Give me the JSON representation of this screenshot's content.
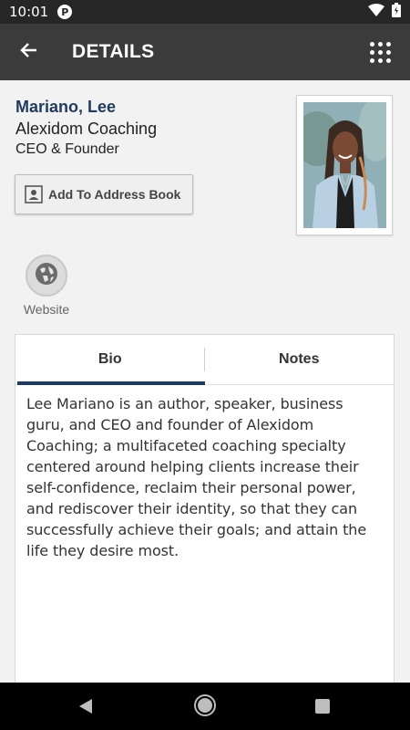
{
  "status_bar": {
    "time": "10:01",
    "app_badge": "P",
    "icons": [
      "wifi-icon",
      "battery-icon"
    ]
  },
  "app_bar": {
    "title": "DETAILS",
    "back_icon": "arrow-left-icon",
    "menu_icon": "grid-menu-icon"
  },
  "contact": {
    "name": "Mariano, Lee",
    "company": "Alexidom Coaching",
    "role": "CEO & Founder",
    "add_button_label": "Add To Address Book",
    "add_button_icon": "contact-card-icon",
    "photo_icon": "profile-photo"
  },
  "website": {
    "label": "Website",
    "icon": "globe-icon"
  },
  "tabs": {
    "items": [
      {
        "label": "Bio",
        "active": true
      },
      {
        "label": "Notes",
        "active": false
      }
    ]
  },
  "bio": {
    "text": "Lee Mariano is an author, speaker, business guru, and CEO and founder of Alexidom Coaching; a multifaceted coaching specialty centered around helping clients increase their self-confidence, reclaim their personal power, and rediscover their identity, so that they can successfully achieve their goals; and attain the life they desire most."
  },
  "colors": {
    "app_bar": "#3b3b3b",
    "status_bar": "#262626",
    "accent": "#1f3a5f",
    "background": "#f2f2f2"
  },
  "nav_bar": {
    "icons": [
      "back-triangle-icon",
      "home-circle-icon",
      "recents-square-icon"
    ]
  }
}
